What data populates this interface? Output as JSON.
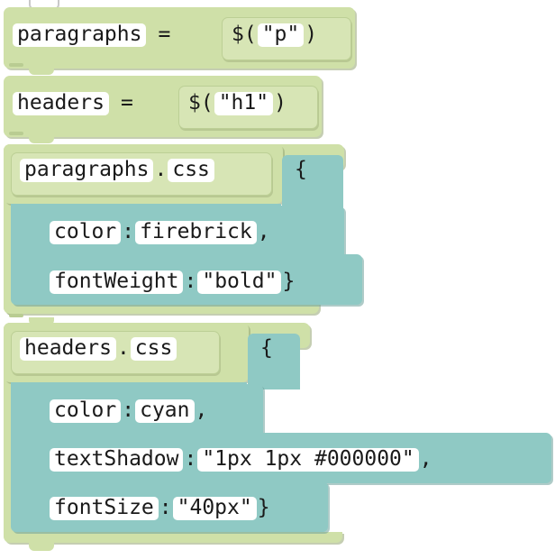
{
  "editor": {
    "name": "block-code-workspace",
    "language": "javascript-jquery",
    "theme": {
      "statement_block_color": "#cfe0a8",
      "statement_block_inner_color": "#d7e5b5",
      "object_block_color": "#8fc9c4",
      "socket_color": "#ffffff",
      "text_color": "#1a1a1a",
      "canvas_color": "#ffffff"
    }
  },
  "script": {
    "blocks": [
      {
        "id": "assign-paragraphs",
        "kind": "assignment",
        "variable": "paragraphs",
        "operator": "=",
        "value": {
          "kind": "jquery-selector",
          "prefix": "$(",
          "selector": "\"p\"",
          "suffix": ")"
        }
      },
      {
        "id": "assign-headers",
        "kind": "assignment",
        "variable": "headers",
        "operator": "=",
        "value": {
          "kind": "jquery-selector",
          "prefix": "$(",
          "selector": "\"h1\"",
          "suffix": ")"
        }
      },
      {
        "id": "css-paragraphs",
        "kind": "method-call",
        "target": "paragraphs",
        "dot": ".",
        "method": "css",
        "open_brace": "{",
        "properties": [
          {
            "key": "color",
            "colon": ":",
            "value": "firebrick",
            "trailing": ","
          },
          {
            "key": "fontWeight",
            "colon": ":",
            "value": "\"bold\"",
            "trailing": "}"
          }
        ]
      },
      {
        "id": "css-headers",
        "kind": "method-call",
        "target": "headers",
        "dot": ".",
        "method": "css",
        "open_brace": "{",
        "properties": [
          {
            "key": "color",
            "colon": ":",
            "value": "cyan",
            "trailing": ","
          },
          {
            "key": "textShadow",
            "colon": ":",
            "value": "\"1px 1px #000000\"",
            "trailing": ","
          },
          {
            "key": "fontSize",
            "colon": ":",
            "value": "\"40px\"",
            "trailing": "}"
          }
        ]
      }
    ]
  }
}
